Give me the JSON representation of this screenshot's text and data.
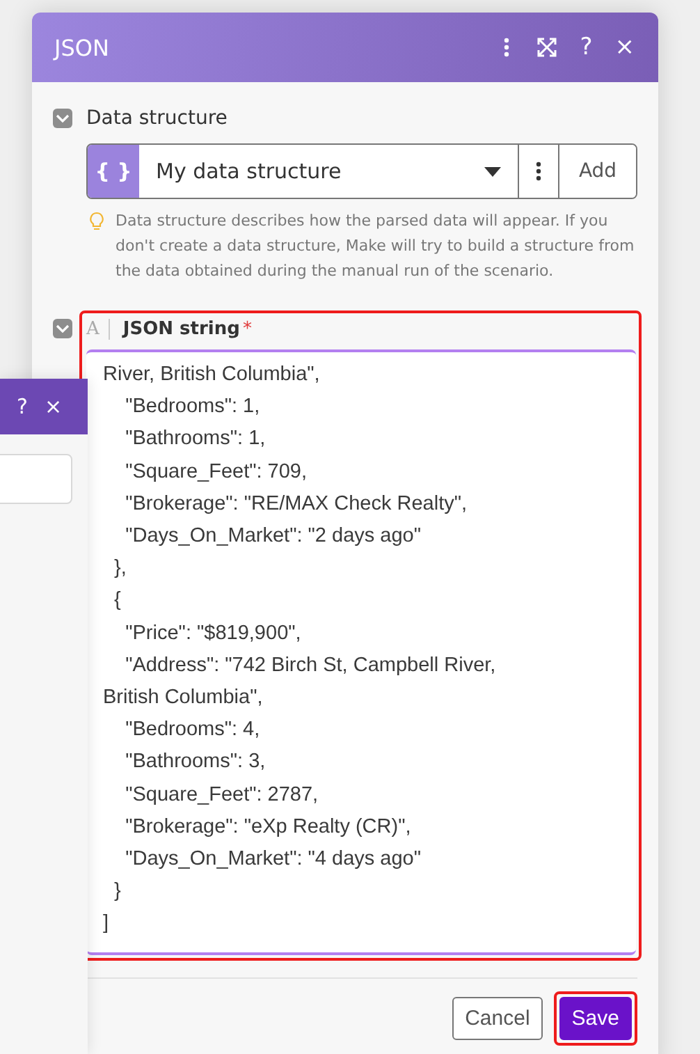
{
  "back_panel": {
    "help": "?",
    "close": "×"
  },
  "dialog": {
    "title": "JSON",
    "help": "?",
    "close": "×"
  },
  "data_structure": {
    "label": "Data structure",
    "expanded": true,
    "icon_text": "{ }",
    "value": "My data structure",
    "add": "Add",
    "hint": "Data structure describes how the parsed data will appear. If you don't create a data structure, Make will try to build a structure from the data obtained during the manual run of the scenario."
  },
  "json_string": {
    "type_icon": "A",
    "label": "JSON string",
    "required_mark": "*",
    "expanded": true,
    "highlighted": true,
    "lines": [
      "River, British Columbia\",",
      "    \"Bedrooms\": 1,",
      "    \"Bathrooms\": 1,",
      "    \"Square_Feet\": 709,",
      "    \"Brokerage\": \"RE/MAX Check Realty\",",
      "    \"Days_On_Market\": \"2 days ago\"",
      "  },",
      "  {",
      "    \"Price\": \"$819,900\",",
      "    \"Address\": \"742 Birch St, Campbell River,",
      "British Columbia\",",
      "    \"Bedrooms\": 4,",
      "    \"Bathrooms\": 3,",
      "    \"Square_Feet\": 2787,",
      "    \"Brokerage\": \"eXp Realty (CR)\",",
      "    \"Days_On_Market\": \"4 days ago\"",
      "  }",
      "]"
    ]
  },
  "buttons": [
    {
      "label": "Cancel",
      "kind": "secondary",
      "highlighted": false
    },
    {
      "label": "Save",
      "kind": "primary",
      "highlighted": true
    }
  ]
}
